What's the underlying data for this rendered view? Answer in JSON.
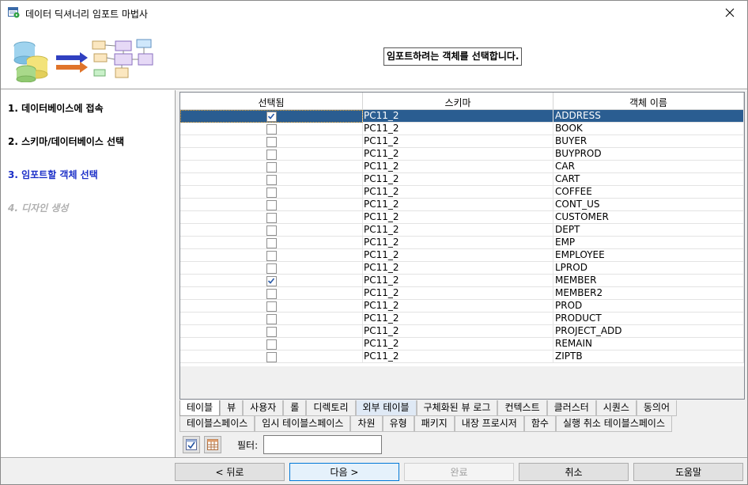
{
  "window": {
    "title": "데이터 딕셔너리 임포트 마법사"
  },
  "banner": {
    "heading": "임포트하려는 객체를 선택합니다."
  },
  "steps": [
    {
      "label": "1. 데이터베이스에 접속",
      "state": "done"
    },
    {
      "label": "2. 스키마/데이터베이스 선택",
      "state": "done"
    },
    {
      "label": "3. 임포트할 객체 선택",
      "state": "current"
    },
    {
      "label": "4. 디자인 생성",
      "state": "future"
    }
  ],
  "grid": {
    "columns": [
      "선택됨",
      "스키마",
      "객체 이름"
    ],
    "rows": [
      {
        "checked": true,
        "schema": "PC11_2",
        "name": "ADDRESS",
        "selected": true
      },
      {
        "checked": false,
        "schema": "PC11_2",
        "name": "BOOK"
      },
      {
        "checked": false,
        "schema": "PC11_2",
        "name": "BUYER"
      },
      {
        "checked": false,
        "schema": "PC11_2",
        "name": "BUYPROD"
      },
      {
        "checked": false,
        "schema": "PC11_2",
        "name": "CAR"
      },
      {
        "checked": false,
        "schema": "PC11_2",
        "name": "CART"
      },
      {
        "checked": false,
        "schema": "PC11_2",
        "name": "COFFEE"
      },
      {
        "checked": false,
        "schema": "PC11_2",
        "name": "CONT_US"
      },
      {
        "checked": false,
        "schema": "PC11_2",
        "name": "CUSTOMER"
      },
      {
        "checked": false,
        "schema": "PC11_2",
        "name": "DEPT"
      },
      {
        "checked": false,
        "schema": "PC11_2",
        "name": "EMP"
      },
      {
        "checked": false,
        "schema": "PC11_2",
        "name": "EMPLOYEE"
      },
      {
        "checked": false,
        "schema": "PC11_2",
        "name": "LPROD"
      },
      {
        "checked": true,
        "schema": "PC11_2",
        "name": "MEMBER"
      },
      {
        "checked": false,
        "schema": "PC11_2",
        "name": "MEMBER2"
      },
      {
        "checked": false,
        "schema": "PC11_2",
        "name": "PROD"
      },
      {
        "checked": false,
        "schema": "PC11_2",
        "name": "PRODUCT"
      },
      {
        "checked": false,
        "schema": "PC11_2",
        "name": "PROJECT_ADD"
      },
      {
        "checked": false,
        "schema": "PC11_2",
        "name": "REMAIN"
      },
      {
        "checked": false,
        "schema": "PC11_2",
        "name": "ZIPTB"
      }
    ]
  },
  "tabs": {
    "row1": [
      "테이블",
      "뷰",
      "사용자",
      "롤",
      "디렉토리",
      "외부 테이블",
      "구체화된 뷰 로그",
      "컨텍스트",
      "클러스터",
      "시퀀스",
      "동의어"
    ],
    "row2": [
      "테이블스페이스",
      "임시 테이블스페이스",
      "차원",
      "유형",
      "패키지",
      "내장 프로시저",
      "함수",
      "실행 취소 테이블스페이스"
    ],
    "active": "테이블",
    "hover": "외부 테이블"
  },
  "filter": {
    "label": "필터:",
    "value": ""
  },
  "buttons": {
    "back": "< 뒤로",
    "next": "다음 >",
    "finish": "완료",
    "cancel": "취소",
    "help": "도움말"
  },
  "colors": {
    "selection": "#2a5d91",
    "current_step": "#1c30c8",
    "future_step": "#b0b0b0"
  }
}
